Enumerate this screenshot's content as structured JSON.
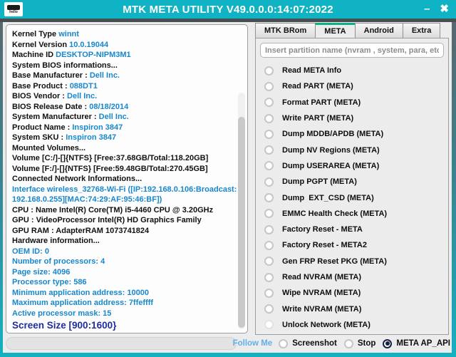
{
  "window": {
    "title": "MTK META UTILITY V49.0.0.0:14:07:2022",
    "logo_text": "hello",
    "minimize_label": "–",
    "close_label": "✖"
  },
  "colors": {
    "titlebar_teal": "#10b3c3",
    "active_tab_accent": "#0cb183",
    "value_blue": "#1787cd",
    "screen_size_navy": "#1f2d9e",
    "follow_me_blue": "#5fafe9"
  },
  "left_panel": {
    "lines": [
      {
        "label": "Kernel Type ",
        "value": "winnt",
        "cls": ""
      },
      {
        "label": "Kernel Version ",
        "value": "10.0.19044",
        "cls": ""
      },
      {
        "label": "Machine ID ",
        "value": "DESKTOP-NIPM3M1",
        "cls": ""
      },
      {
        "label": "System BIOS informations...",
        "value": "",
        "cls": ""
      },
      {
        "label": "Base Manufacturer : ",
        "value": "Dell Inc.",
        "cls": ""
      },
      {
        "label": "Base Product : ",
        "value": "088DT1",
        "cls": ""
      },
      {
        "label": "BIOS Vendor : ",
        "value": "Dell Inc.",
        "cls": ""
      },
      {
        "label": "BIOS Release Date : ",
        "value": "08/18/2014",
        "cls": ""
      },
      {
        "label": "System Manufacturer : ",
        "value": "Dell Inc.",
        "cls": ""
      },
      {
        "label": "Product Name : ",
        "value": "Inspiron 3847",
        "cls": ""
      },
      {
        "label": "System SKU : ",
        "value": "Inspiron 3847",
        "cls": ""
      },
      {
        "label": "Mounted Volumes...",
        "value": "",
        "cls": ""
      },
      {
        "label": "Volume [C:/]-[]{NTFS} [Free:37.68GB/Total:118.20GB]",
        "value": "",
        "cls": ""
      },
      {
        "label": "Volume [F:/]-[]{NTFS} [Free:59.48GB/Total:270.45GB]",
        "value": "",
        "cls": ""
      },
      {
        "label": "Connected Network Informations...",
        "value": "",
        "cls": ""
      },
      {
        "label": "Interface wireless_32768-Wi-Fi ([IP:192.168.0.106:Broadcast:",
        "value": "",
        "cls": "blue"
      },
      {
        "label": "192.168.0.255][MAC:74:29:AF:95:46:BF])",
        "value": "",
        "cls": "blue"
      },
      {
        "label": "CPU  : Name Intel(R) Core(TM) i5-4460 CPU @ 3.20GHz",
        "value": "",
        "cls": ""
      },
      {
        "label": "GPU  : VideoProcessor Intel(R) HD Graphics Family",
        "value": "",
        "cls": ""
      },
      {
        "label": "GPU RAM  : AdapterRAM 1073741824",
        "value": "",
        "cls": ""
      },
      {
        "label": "Hardware information...",
        "value": "",
        "cls": ""
      },
      {
        "label": "OEM ID: 0",
        "value": "",
        "cls": "blue"
      },
      {
        "label": "Number of processors: 4",
        "value": "",
        "cls": "blue"
      },
      {
        "label": "Page size: 4096",
        "value": "",
        "cls": "blue"
      },
      {
        "label": "Processor type: 586",
        "value": "",
        "cls": "blue"
      },
      {
        "label": "Minimum application address: 10000",
        "value": "",
        "cls": "blue"
      },
      {
        "label": "Maximum application address: 7ffeffff",
        "value": "",
        "cls": "blue"
      },
      {
        "label": "Active processor mask: 15",
        "value": "",
        "cls": "blue"
      },
      {
        "label": "Screen Size [900:1600}",
        "value": "",
        "cls": "big"
      }
    ]
  },
  "right_panel": {
    "tabs": [
      {
        "label": "MTK BRom",
        "active": false
      },
      {
        "label": "META",
        "active": true
      },
      {
        "label": "Android",
        "active": false
      },
      {
        "label": "Extra",
        "active": false
      }
    ],
    "partition_input": {
      "placeholder": "Insert partition name (nvram , system, para, etc).",
      "value": ""
    },
    "options": [
      {
        "label": "Read META Info",
        "disabled": false,
        "selected": false
      },
      {
        "label": "Read PART (META)",
        "disabled": false,
        "selected": false
      },
      {
        "label": "Format PART (META)",
        "disabled": false,
        "selected": false
      },
      {
        "label": "Write PART (META)",
        "disabled": false,
        "selected": false
      },
      {
        "label": "Dump MDDB/APDB (META)",
        "disabled": false,
        "selected": false
      },
      {
        "label": "Dump NV Regions (META)",
        "disabled": false,
        "selected": false
      },
      {
        "label": "Dump USERAREA (META)",
        "disabled": false,
        "selected": false
      },
      {
        "label": "Dump PGPT (META)",
        "disabled": false,
        "selected": false
      },
      {
        "label": "Dump  EXT_CSD (META)",
        "disabled": false,
        "selected": false
      },
      {
        "label": "EMMC Health Check (META)",
        "disabled": false,
        "selected": false
      },
      {
        "label": "Factory Reset - META",
        "disabled": false,
        "selected": false
      },
      {
        "label": "Factory Reset - META2",
        "disabled": false,
        "selected": false
      },
      {
        "label": "Gen FRP Reset PKG (META)",
        "disabled": false,
        "selected": false
      },
      {
        "label": "Read NVRAM (META)",
        "disabled": false,
        "selected": false
      },
      {
        "label": "Wipe NVRAM (META)",
        "disabled": false,
        "selected": false
      },
      {
        "label": "Write NVRAM (META)",
        "disabled": false,
        "selected": false
      },
      {
        "label": "Unlock Network (META)",
        "disabled": true,
        "selected": false
      }
    ]
  },
  "footer": {
    "follow_me": "Follow Me",
    "radios": [
      {
        "label": "Screenshot",
        "selected": false
      },
      {
        "label": "Stop",
        "selected": false
      },
      {
        "label": "META AP_API",
        "selected": true
      }
    ]
  }
}
